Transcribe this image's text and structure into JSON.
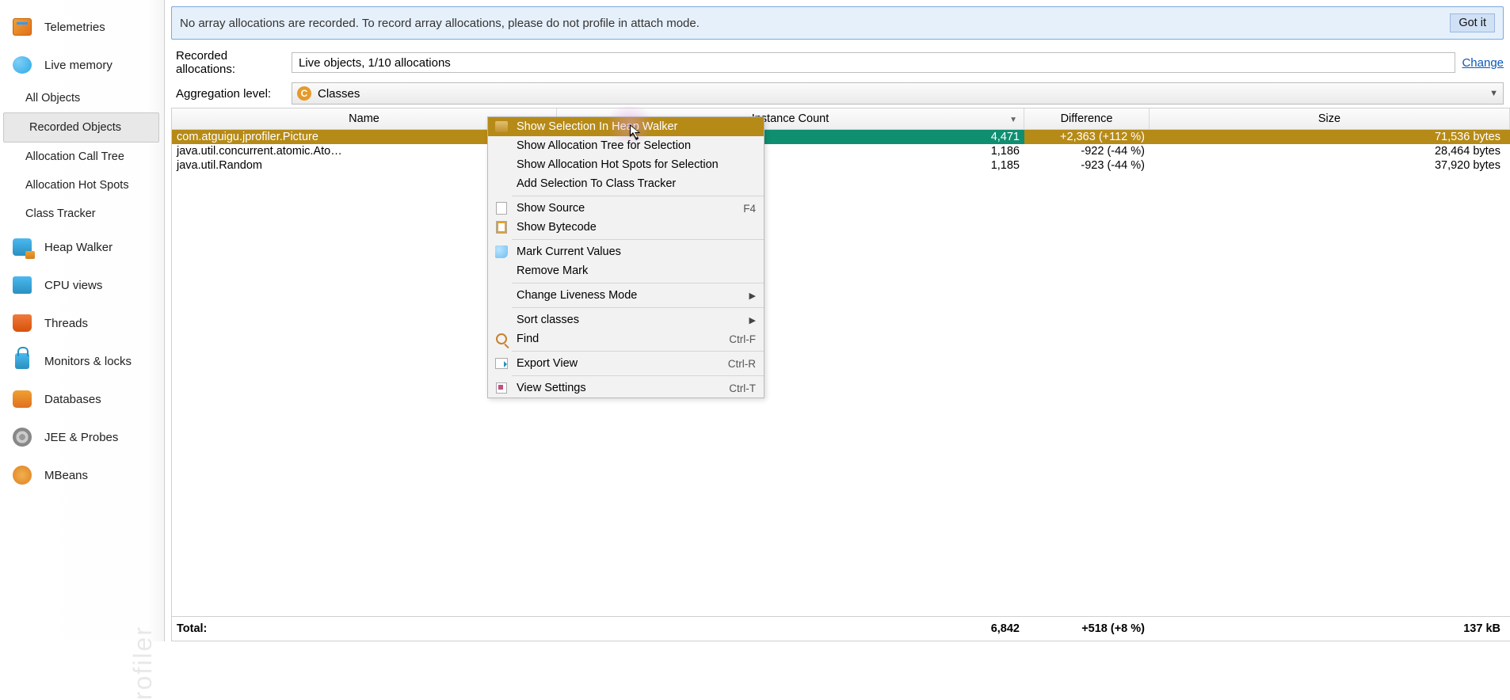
{
  "sidebar": {
    "items": [
      {
        "label": "Telemetries",
        "icon": "telemetries"
      },
      {
        "label": "Live memory",
        "icon": "livemem"
      },
      {
        "label": "All Objects",
        "sub": true
      },
      {
        "label": "Recorded Objects",
        "sub": true,
        "selected": true
      },
      {
        "label": "Allocation Call Tree",
        "sub": true
      },
      {
        "label": "Allocation Hot Spots",
        "sub": true
      },
      {
        "label": "Class Tracker",
        "sub": true
      },
      {
        "label": "Heap Walker",
        "icon": "heap"
      },
      {
        "label": "CPU views",
        "icon": "cpu"
      },
      {
        "label": "Threads",
        "icon": "threads"
      },
      {
        "label": "Monitors & locks",
        "icon": "locks"
      },
      {
        "label": "Databases",
        "icon": "db"
      },
      {
        "label": "JEE & Probes",
        "icon": "jee"
      },
      {
        "label": "MBeans",
        "icon": "mbeans"
      }
    ]
  },
  "banner": {
    "text": "No array allocations are recorded. To record array allocations, please do not profile in attach mode.",
    "button": "Got it"
  },
  "controls": {
    "rec_label": "Recorded allocations:",
    "rec_value": "Live objects, 1/10 allocations",
    "change": "Change",
    "agg_label": "Aggregation level:",
    "agg_value": "Classes"
  },
  "table": {
    "headers": {
      "name": "Name",
      "instance": "Instance Count",
      "diff": "Difference",
      "size": "Size"
    },
    "rows": [
      {
        "name": "com.atguigu.jprofiler.Picture",
        "count": "4,471",
        "bar_pct": 100,
        "diff": "+2,363 (+112 %)",
        "size": "71,536 bytes",
        "selected": true
      },
      {
        "name": "java.util.concurrent.atomic.Ato…",
        "count": "1,186",
        "bar_pct": 26,
        "diff": "-922 (-44 %)",
        "size": "28,464 bytes"
      },
      {
        "name": "java.util.Random",
        "count": "1,185",
        "bar_pct": 26,
        "diff": "-923 (-44 %)",
        "size": "37,920 bytes"
      }
    ],
    "totals": {
      "label": "Total:",
      "count": "6,842",
      "diff": "+518 (+8 %)",
      "size": "137 kB"
    }
  },
  "context_menu": {
    "items": [
      {
        "label": "Show Selection In Heap Walker",
        "icon": "heap",
        "highlight": true
      },
      {
        "label": "Show Allocation Tree for Selection"
      },
      {
        "label": "Show Allocation Hot Spots for Selection"
      },
      {
        "label": "Add Selection To Class Tracker"
      },
      {
        "sep": true
      },
      {
        "label": "Show Source",
        "shortcut": "F4",
        "icon": "source"
      },
      {
        "label": "Show Bytecode",
        "icon": "byte"
      },
      {
        "sep": true
      },
      {
        "label": "Mark Current Values",
        "icon": "mark"
      },
      {
        "label": "Remove Mark"
      },
      {
        "sep": true
      },
      {
        "label": "Change Liveness Mode",
        "submenu": true
      },
      {
        "sep": true
      },
      {
        "label": "Sort classes",
        "submenu": true
      },
      {
        "label": "Find",
        "shortcut": "Ctrl-F",
        "icon": "find"
      },
      {
        "sep": true
      },
      {
        "label": "Export View",
        "shortcut": "Ctrl-R",
        "icon": "export"
      },
      {
        "sep": true
      },
      {
        "label": "View Settings",
        "shortcut": "Ctrl-T",
        "icon": "settings"
      }
    ]
  }
}
